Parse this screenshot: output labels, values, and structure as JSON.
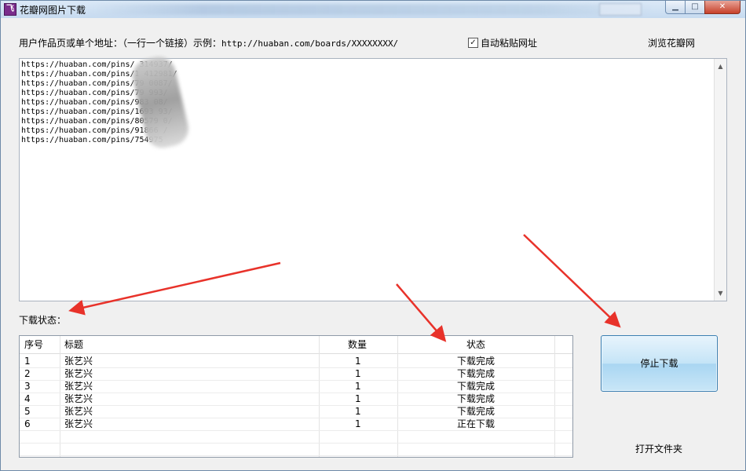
{
  "window": {
    "title": "花瓣网图片下载",
    "app_icon_glyph": "飞",
    "controls": {
      "minimize": "▁",
      "maximize": "□",
      "close": "✕"
    }
  },
  "form": {
    "url_prompt": "用户作品页或单个地址：（一行一个链接）示例：",
    "url_example": "http://huaban.com/boards/XXXXXXXX/",
    "auto_paste_label": "自动粘贴网址",
    "auto_paste_checked": true,
    "browse_link": "浏览花瓣网",
    "urls": [
      "https://huaban.com/pins/   314937/",
      "https://huaban.com/pins/1  412981/",
      "https://huaban.com/pins/79   0087/",
      "https://huaban.com/pins/79    993/",
      "https://huaban.com/pins/983   08/",
      "https://huaban.com/pins/1693    93/",
      "https://huaban.com/pins/80579   0/",
      "https://huaban.com/pins/91866   /",
      "https://huaban.com/pins/754975   "
    ]
  },
  "status": {
    "label": "下载状态：",
    "columns": [
      "序号",
      "标题",
      "数量",
      "状态"
    ],
    "rows": [
      {
        "index": "1",
        "title": "张艺兴",
        "count": "1",
        "state": "下载完成"
      },
      {
        "index": "2",
        "title": "张艺兴",
        "count": "1",
        "state": "下载完成"
      },
      {
        "index": "3",
        "title": "张艺兴",
        "count": "1",
        "state": "下载完成"
      },
      {
        "index": "4",
        "title": "张艺兴",
        "count": "1",
        "state": "下载完成"
      },
      {
        "index": "5",
        "title": "张艺兴",
        "count": "1",
        "state": "下载完成"
      },
      {
        "index": "6",
        "title": "张艺兴",
        "count": "1",
        "state": "正在下载"
      }
    ]
  },
  "actions": {
    "stop_download": "停止下载",
    "open_folder": "打开文件夹"
  },
  "colors": {
    "annotation_arrow": "#e8322a",
    "button_border": "#3c7fb1"
  }
}
